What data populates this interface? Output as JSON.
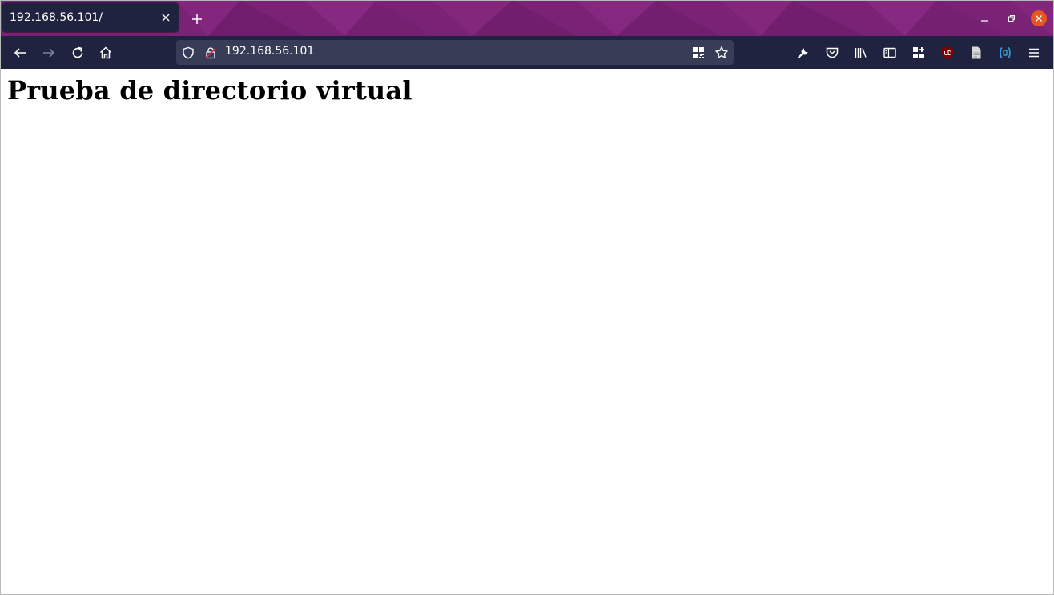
{
  "browser": {
    "tab": {
      "title": "192.168.56.101/"
    },
    "url": "192.168.56.101",
    "theme": {
      "tabstrip": "#7a2276",
      "toolbar": "#1f2340",
      "urlbar": "#373c57",
      "close_button": "#e95420"
    },
    "icons": {
      "back": "arrow-left-icon",
      "forward": "arrow-right-icon",
      "reload": "reload-icon",
      "home": "home-icon",
      "tracking": "shield-icon",
      "insecure": "lock-warning-icon",
      "qr": "qr-code-icon",
      "bookmark": "star-icon",
      "devtools": "wrench-icon",
      "pocket": "pocket-icon",
      "library": "library-icon",
      "sidebar": "sidebar-icon",
      "extensions": "extensions-icon",
      "ublock": "ublock-icon",
      "document": "document-icon",
      "bracket_ext": "bracket-extension-icon",
      "menu": "hamburger-menu-icon"
    }
  },
  "page": {
    "heading": "Prueba de directorio virtual"
  }
}
